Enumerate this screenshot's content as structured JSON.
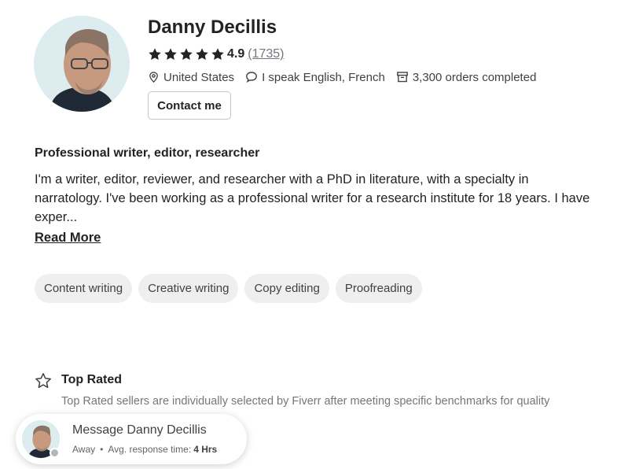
{
  "profile": {
    "name": "Danny Decillis",
    "rating": "4.9",
    "review_count": "(1735)",
    "location": "United States",
    "languages": "I speak English, French",
    "orders": "3,300 orders completed",
    "contact_label": "Contact me",
    "star_color": "#222325",
    "star_count": 5
  },
  "about": {
    "headline": "Professional writer, editor, researcher",
    "description": "I'm a writer, editor, reviewer, and researcher with a PhD in literature, with a specialty in narratology. I've been working as a professional writer for a research institute for 18 years. I have exper...",
    "read_more": "Read More"
  },
  "skills": [
    "Content writing",
    "Creative writing",
    "Copy editing",
    "Proofreading"
  ],
  "badge": {
    "icon": "star-outline-icon",
    "title": "Top Rated",
    "description": "Top Rated sellers are individually selected by Fiverr after meeting specific benchmarks for quality"
  },
  "message": {
    "title": "Message Danny Decillis",
    "status": "Away",
    "separator": "•",
    "response_label": "Avg. response time:",
    "response_value": "4 Hrs"
  }
}
